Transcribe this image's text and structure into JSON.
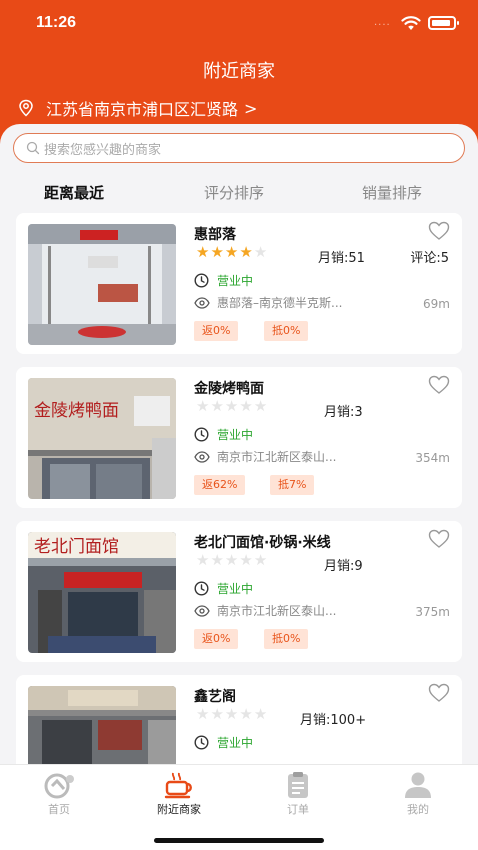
{
  "status_bar": {
    "time": "11:26",
    "signal": "····"
  },
  "header": {
    "title": "附近商家",
    "location": "江苏省南京市浦口区汇贤路",
    "chevron": ">"
  },
  "search": {
    "placeholder": "搜索您感兴趣的商家"
  },
  "sort_tabs": [
    {
      "label": "距离最近",
      "active": true
    },
    {
      "label": "评分排序",
      "active": false
    },
    {
      "label": "销量排序",
      "active": false
    }
  ],
  "merchants": [
    {
      "name": "惠部落",
      "rating": 4,
      "sales": "月销:51",
      "reviews": "评论:5",
      "status": "营业中",
      "address": "惠部落–南京德半克斯...",
      "distance": "69m",
      "rebate": "返0%",
      "deduct": "抵0%",
      "sign": ""
    },
    {
      "name": "金陵烤鸭面",
      "rating": 0,
      "sales": "月销:3",
      "reviews": "",
      "status": "营业中",
      "address": "南京市江北新区泰山...",
      "distance": "354m",
      "rebate": "返62%",
      "deduct": "抵7%",
      "sign": "金陵烤鸭面"
    },
    {
      "name": "老北门面馆·砂锅·米线",
      "rating": 0,
      "sales": "月销:9",
      "reviews": "",
      "status": "营业中",
      "address": "南京市江北新区泰山...",
      "distance": "375m",
      "rebate": "返0%",
      "deduct": "抵0%",
      "sign": "老北门面馆"
    },
    {
      "name": "鑫艺阁",
      "rating": 0,
      "sales": "月销:100+",
      "reviews": "",
      "status": "营业中",
      "address": "",
      "distance": "",
      "rebate": "",
      "deduct": "",
      "sign": ""
    }
  ],
  "tabbar": [
    {
      "label": "首页",
      "icon": "home-logo-icon",
      "active": false
    },
    {
      "label": "附近商家",
      "icon": "coffee-cup-icon",
      "active": true
    },
    {
      "label": "订单",
      "icon": "clipboard-icon",
      "active": false
    },
    {
      "label": "我的",
      "icon": "person-icon",
      "active": false
    }
  ],
  "colors": {
    "brand": "#e84a17",
    "open_status": "#2aa52e",
    "star": "#f5a623",
    "badge_bg": "#ffe3d6"
  }
}
